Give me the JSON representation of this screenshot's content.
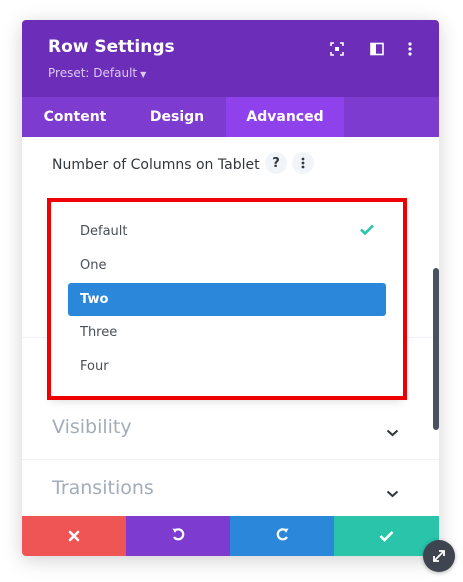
{
  "colors": {
    "header_bg": "#6c2eb9",
    "tabs_bg": "#7e3bd0",
    "tab_active_bg": "#8f42ec",
    "selected_option": "#2b87da",
    "check": "#29c4a9",
    "highlight_border": "#ee0000",
    "footer_cancel": "#ef5555",
    "footer_undo": "#7e3bd0",
    "footer_redo": "#2b87da",
    "footer_save": "#29c4a9"
  },
  "header": {
    "title": "Row Settings",
    "preset_label": "Preset: Default",
    "icons": [
      "expand-icon",
      "sidebar-layout-icon",
      "more-vertical-icon"
    ]
  },
  "tabs": [
    {
      "label": "Content",
      "active": false
    },
    {
      "label": "Design",
      "active": false
    },
    {
      "label": "Advanced",
      "active": true
    }
  ],
  "field": {
    "label": "Number of Columns on Tablet",
    "help": "?"
  },
  "dropdown": {
    "options": [
      {
        "label": "Default",
        "checked": true
      },
      {
        "label": "One"
      },
      {
        "label": "Two",
        "highlighted": true
      },
      {
        "label": "Three"
      },
      {
        "label": "Four"
      }
    ]
  },
  "sections": [
    {
      "title": "Visibility"
    },
    {
      "title": "Transitions"
    }
  ],
  "footer": {
    "buttons": [
      "close-icon",
      "undo-icon",
      "redo-icon",
      "check-icon"
    ]
  }
}
